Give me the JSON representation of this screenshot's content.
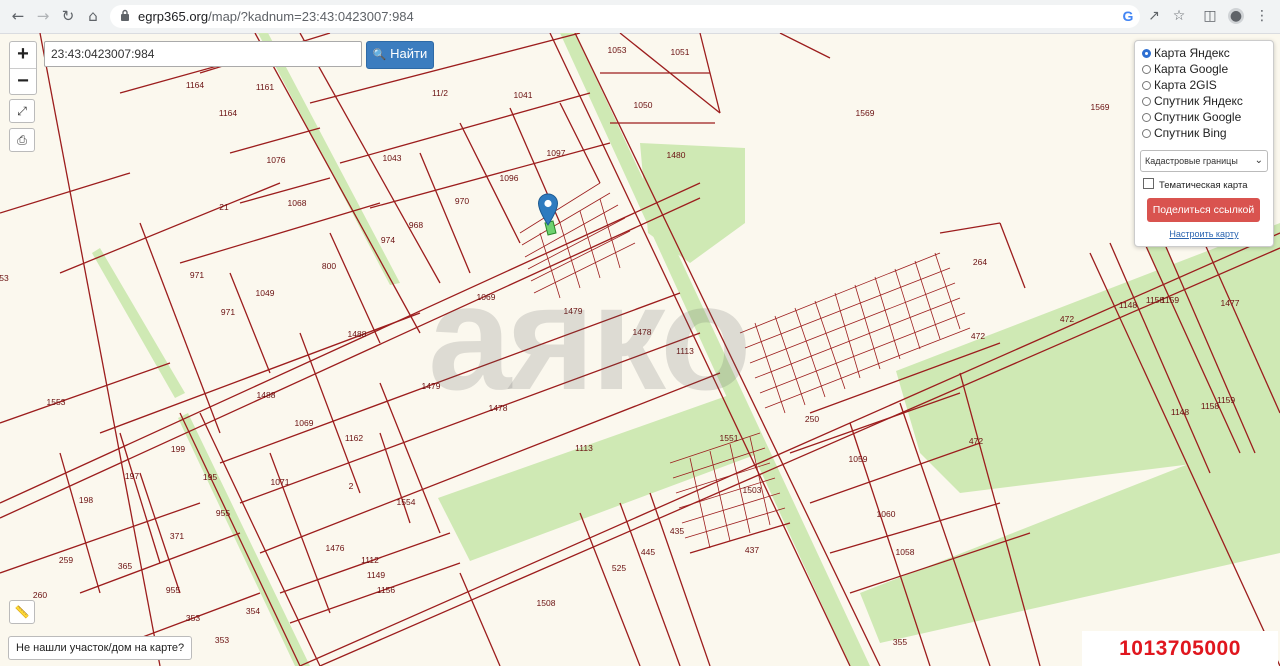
{
  "browser": {
    "url_host": "egrp365.org",
    "url_path": "/map/?kadnum=23:43:0423007:984",
    "back_icon": "arrow-left-icon",
    "forward_icon": "arrow-right-icon",
    "reload_icon": "reload-icon",
    "home_icon": "home-icon"
  },
  "search": {
    "value": "23:43:0423007:984",
    "button_label": "Найти"
  },
  "zoom": {
    "in_label": "+",
    "out_label": "−"
  },
  "layers_panel": {
    "options": [
      "Карта Яндекс",
      "Карта Google",
      "Карта 2GIS",
      "Спутник Яндекс",
      "Спутник Google",
      "Спутник Bing"
    ],
    "selected_index": 0,
    "select_value": "Кадастровые границы",
    "thematic_label": "Тематическая карта",
    "share_label": "Поделиться ссылкой",
    "configure_label": "Настроить карту"
  },
  "not_found_label": "Не нашли участок/дом на карте?",
  "listing_id": "1013705000",
  "watermark_text": "аяко",
  "colors": {
    "boundary": "#9c1d1d",
    "greenery": "#cfe9b4",
    "background": "#fbf8ee",
    "accent": "#3c7dbf",
    "share": "#d9534f",
    "id_text": "#e0161e"
  },
  "plot_numbers": [
    "1053",
    "1051",
    "1164",
    "1161",
    "11/2",
    "1041",
    "1050",
    "1569",
    "1569",
    "1164",
    "1043",
    "1097",
    "1480",
    "1076",
    "1096",
    "21",
    "1068",
    "970",
    "968",
    "974",
    "800",
    "971",
    "1049",
    "264",
    "53",
    "1069",
    "1479",
    "971",
    "1488",
    "1478",
    "472",
    "472",
    "1113",
    "1148",
    "1158",
    "1159",
    "1477",
    "1553",
    "1488",
    "1479",
    "1478",
    "250",
    "1069",
    "1162",
    "199",
    "472",
    "1148",
    "1158",
    "1159",
    "1551",
    "1113",
    "1059",
    "197",
    "198",
    "1071",
    "2",
    "1503",
    "195",
    "1554",
    "955",
    "371",
    "435",
    "1060",
    "1476",
    "525",
    "445",
    "437",
    "1058",
    "365",
    "1112",
    "259",
    "1149",
    "955",
    "1156",
    "260",
    "353",
    "354",
    "1508",
    "353",
    "355"
  ]
}
